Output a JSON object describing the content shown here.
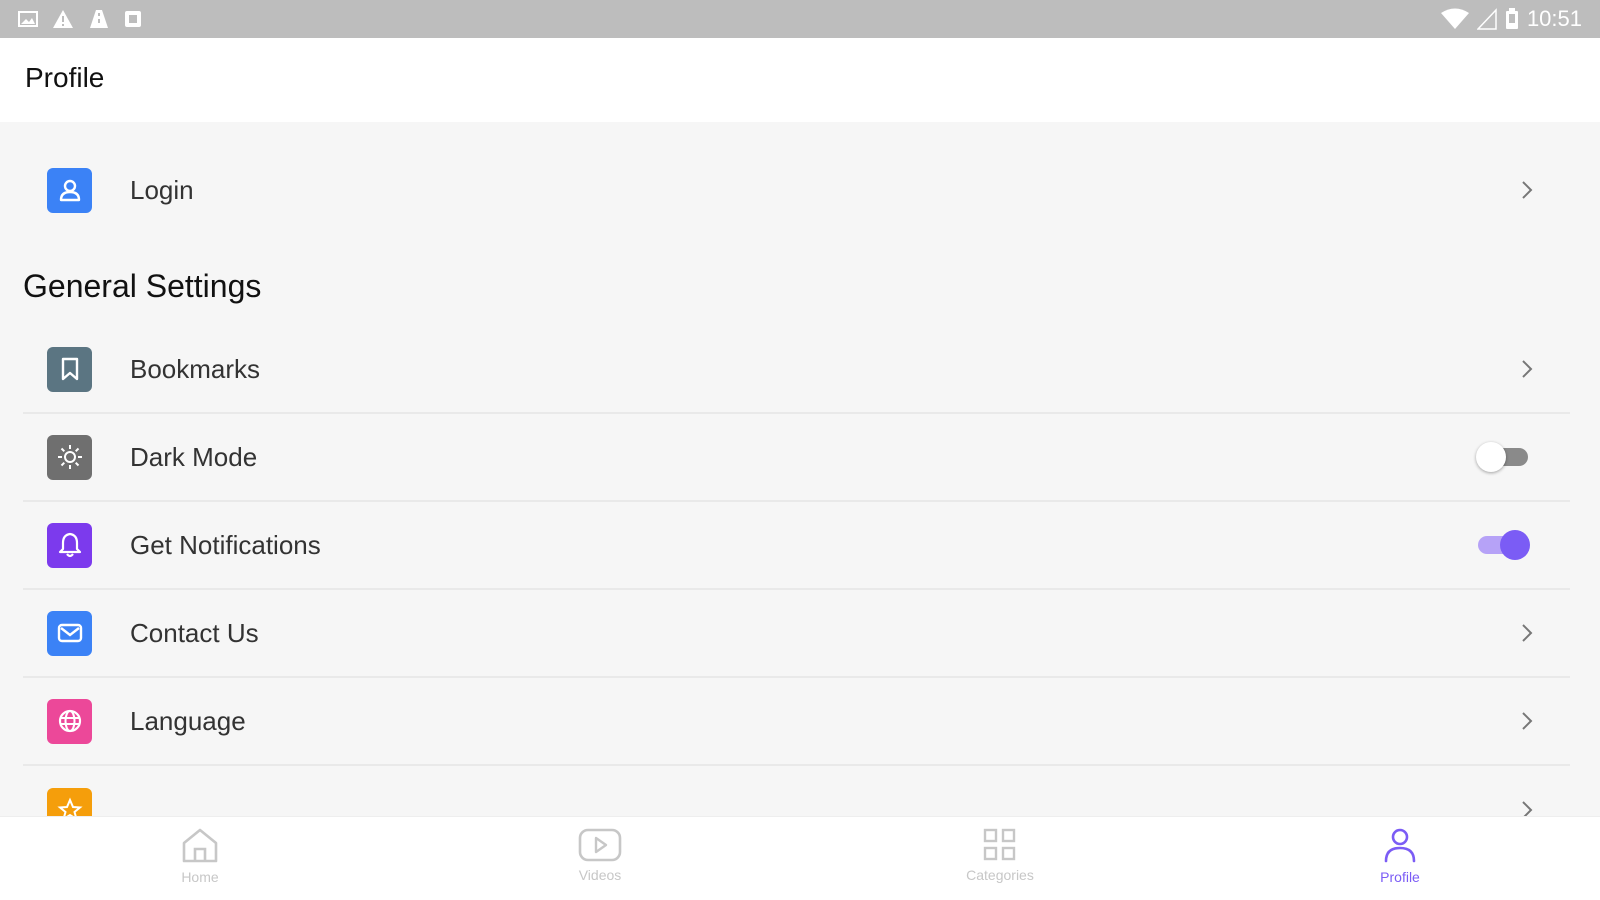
{
  "status_bar": {
    "time": "10:51"
  },
  "header": {
    "title": "Profile"
  },
  "login": {
    "label": "Login",
    "icon": "user-icon",
    "color": "#3b82f6"
  },
  "general": {
    "title": "General Settings",
    "items": [
      {
        "label": "Bookmarks",
        "icon": "bookmark-icon",
        "color": "#5b7582",
        "control": "chevron"
      },
      {
        "label": "Dark Mode",
        "icon": "sun-icon",
        "color": "#6f6f6f",
        "control": "toggle",
        "on": false
      },
      {
        "label": "Get Notifications",
        "icon": "bell-icon",
        "color": "#7c3aed",
        "control": "toggle",
        "on": true
      },
      {
        "label": "Contact Us",
        "icon": "mail-icon",
        "color": "#3b82f6",
        "control": "chevron"
      },
      {
        "label": "Language",
        "icon": "globe-icon",
        "color": "#ec4899",
        "control": "chevron"
      },
      {
        "label": "",
        "icon": "star-icon",
        "color": "#f59e0b",
        "control": "chevron"
      }
    ]
  },
  "nav": {
    "items": [
      {
        "label": "Home",
        "icon": "home-icon",
        "active": false
      },
      {
        "label": "Videos",
        "icon": "play-icon",
        "active": false
      },
      {
        "label": "Categories",
        "icon": "grid-icon",
        "active": false
      },
      {
        "label": "Profile",
        "icon": "profile-icon",
        "active": true
      }
    ]
  },
  "colors": {
    "accent": "#7b5cf5",
    "inactive": "#c7c7c7"
  }
}
